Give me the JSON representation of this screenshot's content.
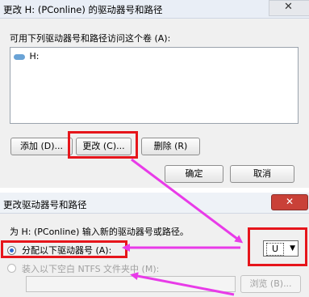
{
  "dialog1": {
    "title": "更改 H: (PConline) 的驱动器号和路径",
    "close_glyph": "✕",
    "access_label": "可用下列驱动器号和路径访问这个卷 (A):",
    "list_items": [
      {
        "label": "H:"
      }
    ],
    "buttons": {
      "add": "添加 (D)...",
      "change": "更改 (C)...",
      "delete": "删除 (R)",
      "ok": "确定",
      "cancel": "取消"
    }
  },
  "dialog2": {
    "title": "更改驱动器号和路径",
    "close_glyph": "✕",
    "instruction": "为 H: (PConline) 输入新的驱动器号或路径。",
    "option_assign": "分配以下驱动器号 (A):",
    "option_mount": "装入以下空白 NTFS 文件夹中 (M):",
    "drive_letter": "U",
    "browse": "浏览 (B)..."
  },
  "colors": {
    "highlight": "#e6151b",
    "arrow": "#e83be8"
  }
}
